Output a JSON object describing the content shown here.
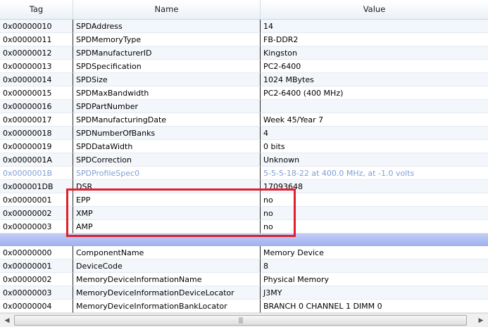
{
  "columns": {
    "tag": "Tag",
    "name": "Name",
    "value": "Value"
  },
  "rows": [
    {
      "tag": "0x00000010",
      "name": "SPDAddress",
      "value": "14"
    },
    {
      "tag": "0x00000011",
      "name": "SPDMemoryType",
      "value": "FB-DDR2"
    },
    {
      "tag": "0x00000012",
      "name": "SPDManufacturerID",
      "value": "Kingston"
    },
    {
      "tag": "0x00000013",
      "name": "SPDSpecification",
      "value": "PC2-6400"
    },
    {
      "tag": "0x00000014",
      "name": "SPDSize",
      "value": "1024 MBytes"
    },
    {
      "tag": "0x00000015",
      "name": "SPDMaxBandwidth",
      "value": "PC2-6400 (400 MHz)"
    },
    {
      "tag": "0x00000016",
      "name": "SPDPartNumber",
      "value": ""
    },
    {
      "tag": "0x00000017",
      "name": "SPDManufacturingDate",
      "value": "Week 45/Year 7"
    },
    {
      "tag": "0x00000018",
      "name": "SPDNumberOfBanks",
      "value": "4"
    },
    {
      "tag": "0x00000019",
      "name": "SPDDataWidth",
      "value": "0 bits"
    },
    {
      "tag": "0x0000001A",
      "name": "SPDCorrection",
      "value": "Unknown"
    },
    {
      "tag": "0x0000001B",
      "name": "SPDProfileSpec0",
      "value": "5-5-5-18-22 at 400.0 MHz, at -1.0 volts",
      "dim": true
    },
    {
      "tag": "0x000001DB",
      "name": "DSR",
      "value": "17093648"
    },
    {
      "tag": "0x00000001",
      "name": "EPP",
      "value": "no"
    },
    {
      "tag": "0x00000002",
      "name": "XMP",
      "value": "no"
    },
    {
      "tag": "0x00000003",
      "name": "AMP",
      "value": "no"
    },
    {
      "separator": true
    },
    {
      "tag": "0x00000000",
      "name": "ComponentName",
      "value": "Memory Device"
    },
    {
      "tag": "0x00000001",
      "name": "DeviceCode",
      "value": "8"
    },
    {
      "tag": "0x00000002",
      "name": "MemoryDeviceInformationName",
      "value": "Physical Memory"
    },
    {
      "tag": "0x00000003",
      "name": "MemoryDeviceInformationDeviceLocator",
      "value": "J3MY"
    },
    {
      "tag": "0x00000004",
      "name": "MemoryDeviceInformationBankLocator",
      "value": "BRANCH 0 CHANNEL 1 DIMM 0"
    }
  ],
  "colors": {
    "highlight": "#e0202e",
    "dim_text": "#7f9fd6",
    "separator": "#9eb0ef"
  },
  "scrollbar": {
    "grip_icon": "grip-lines-icon"
  }
}
